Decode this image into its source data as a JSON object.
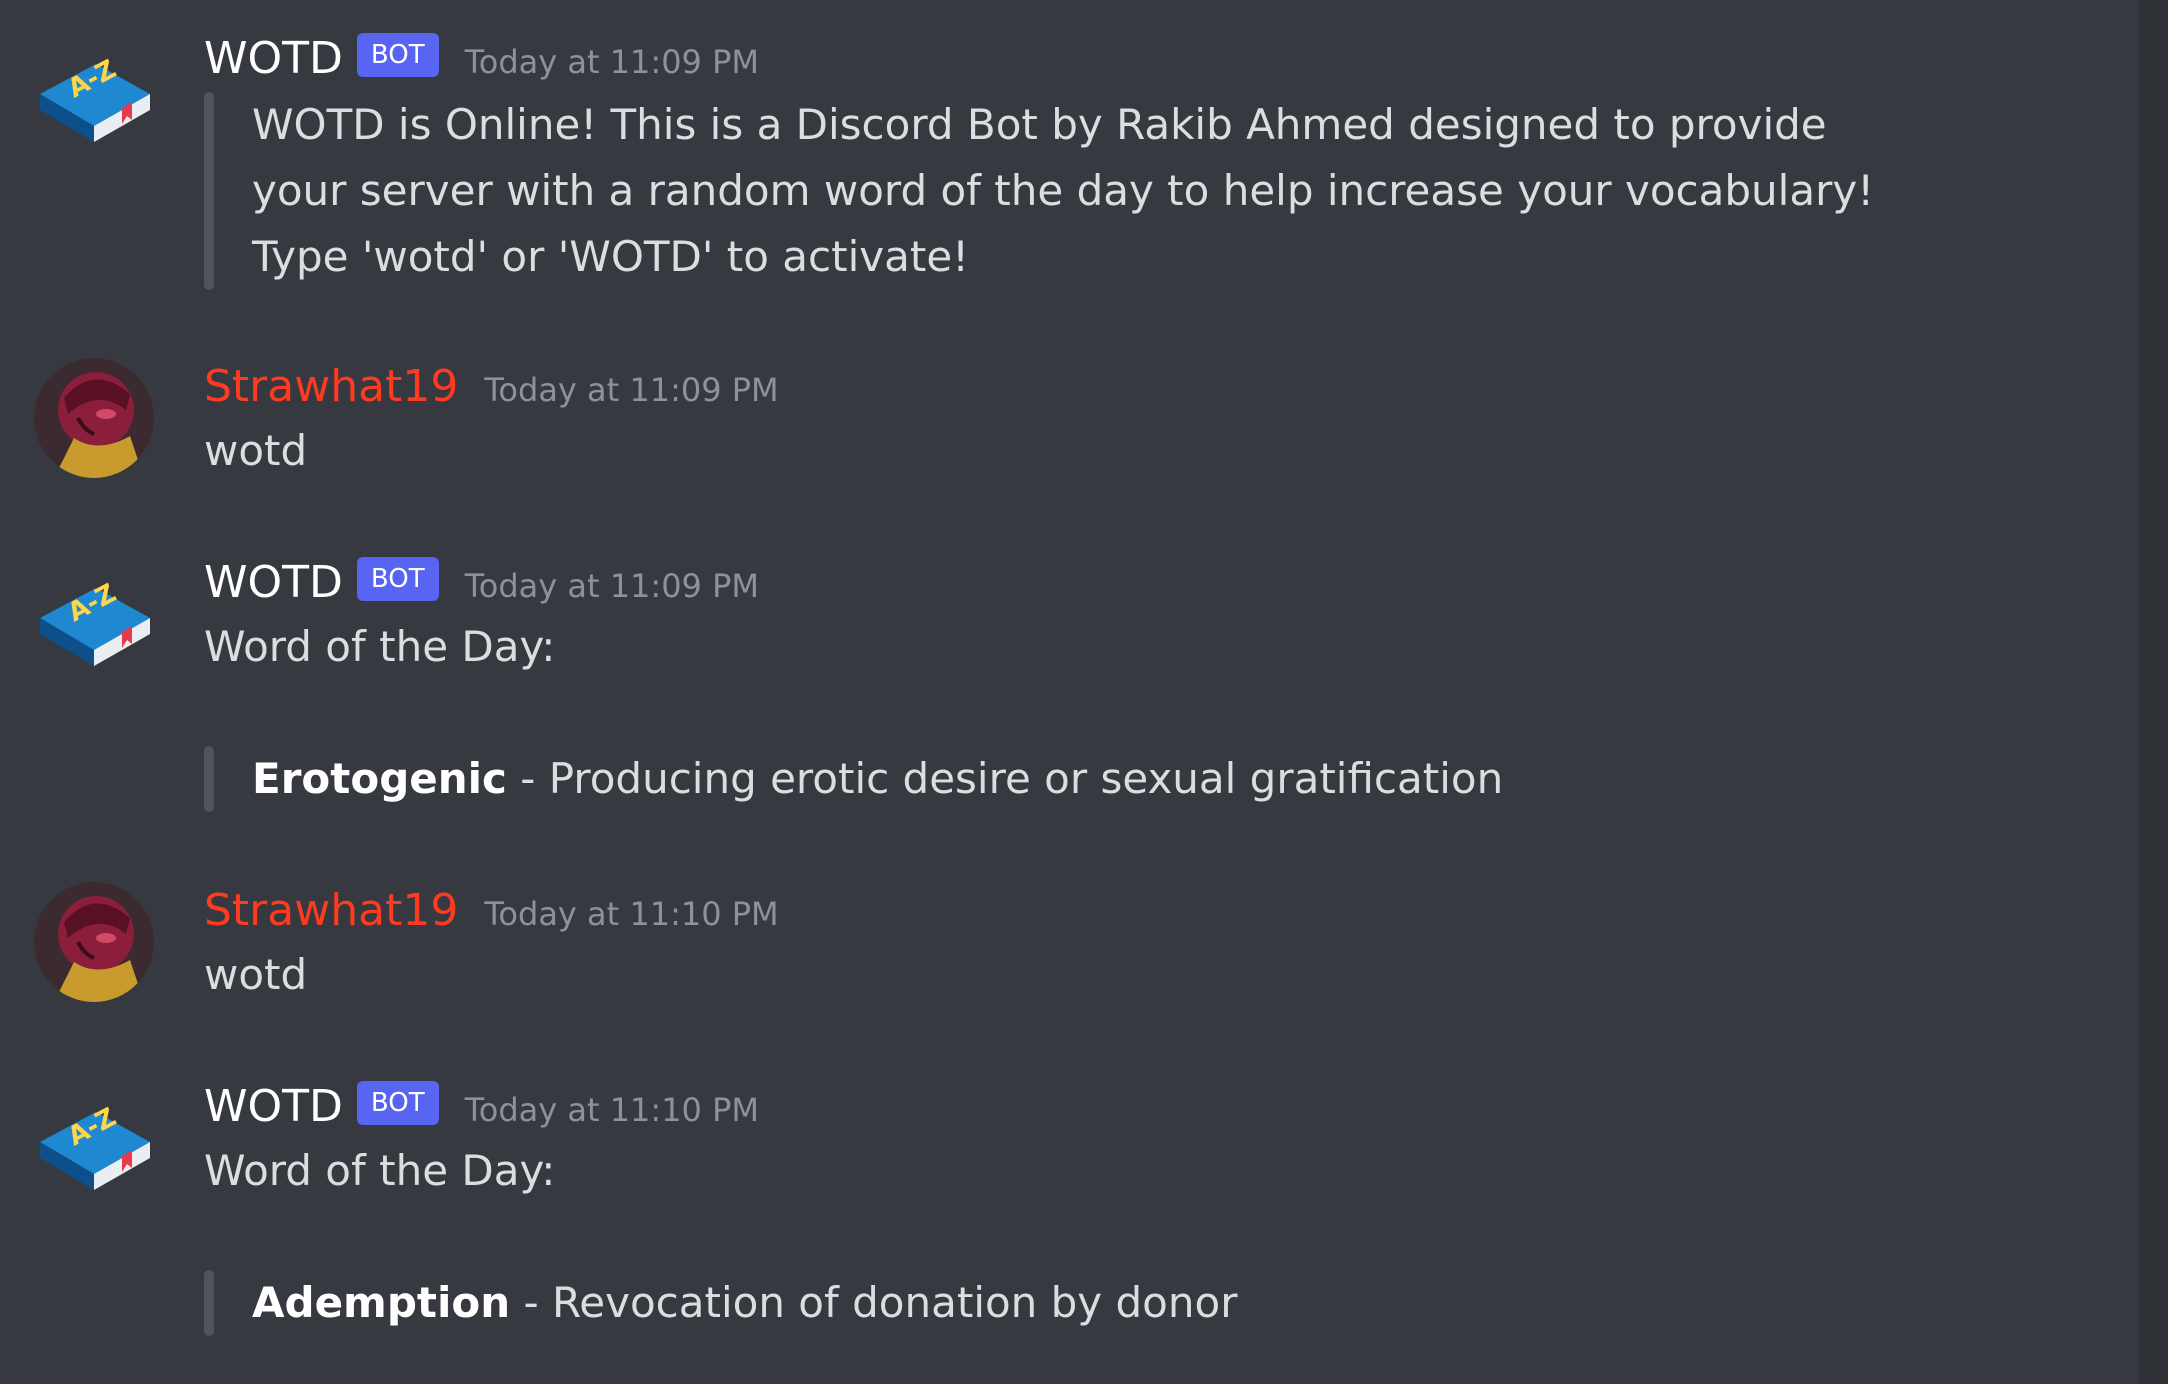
{
  "messages": [
    {
      "author": "WOTD",
      "badge": "BOT",
      "timestamp": "Today at 11:09 PM",
      "quote_lines": [
        "WOTD is Online! This is a Discord Bot by Rakib Ahmed designed to provide",
        "your server with a random word of the day to help increase your vocabulary!",
        "Type 'wotd' or 'WOTD' to activate!"
      ]
    },
    {
      "author": "Strawhat19",
      "timestamp": "Today at 11:09 PM",
      "text": "wotd"
    },
    {
      "author": "WOTD",
      "badge": "BOT",
      "timestamp": "Today at 11:09 PM",
      "text": "Word of the Day:",
      "word": "Erotogenic",
      "definition": " - Producing erotic desire or sexual gratification"
    },
    {
      "author": "Strawhat19",
      "timestamp": "Today at 11:10 PM",
      "text": "wotd"
    },
    {
      "author": "WOTD",
      "badge": "BOT",
      "timestamp": "Today at 11:10 PM",
      "text": "Word of the Day:",
      "word": "Ademption",
      "definition": " - Revocation of donation by donor"
    }
  ],
  "avatars": {
    "bot": {
      "icon": "book-az-icon",
      "label": "A-Z",
      "color": "#1565a8"
    },
    "user": {
      "icon": "user-avatar-icon",
      "color": "#8b1e3a"
    }
  },
  "colors": {
    "background": "#36393f",
    "username_user": "#ff3a20",
    "bot_badge": "#5865f2",
    "timestamp": "#8e9297",
    "quote_bar": "#4f545c"
  }
}
